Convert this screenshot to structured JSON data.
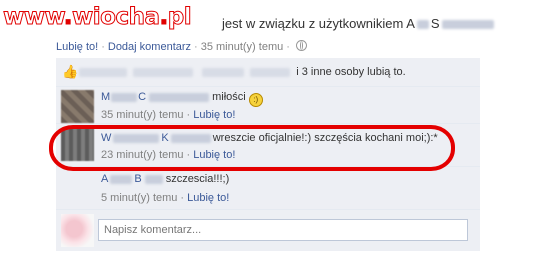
{
  "watermark": {
    "prefix": "www",
    "dot1": ".",
    "name": "wiocha",
    "dot2": ".",
    "tld": "pl"
  },
  "status": {
    "text": "jest w związku z użytkownikiem A",
    "trail": "S"
  },
  "status_meta": {
    "like_label": "Lubię to!",
    "separator": "·",
    "comment_label": "Dodaj komentarz",
    "time": "35 minut(y) temu"
  },
  "likes": {
    "text": "i 3 inne osoby lubią to."
  },
  "comments": [
    {
      "author_initial": "M",
      "author_mid": "C",
      "text": "miłości",
      "time": "35 minut(y) temu",
      "like_label": "Lubię to!"
    },
    {
      "author_initial": "W",
      "author_mid": "K",
      "text": "wreszcie oficjalnie!:) szczęścia kochani moi;):*",
      "time": "23 minut(y) temu",
      "like_label": "Lubię to!"
    },
    {
      "author_initial": "A",
      "author_mid": "B",
      "text": "szczescia!!!;)",
      "time": "5 minut(y) temu",
      "like_label": "Lubię to!"
    }
  ],
  "write_comment": {
    "placeholder": "Napisz komentarz..."
  },
  "colors": {
    "link": "#3b5998",
    "highlight": "#e40000",
    "feedback_bg": "#edeff4"
  }
}
